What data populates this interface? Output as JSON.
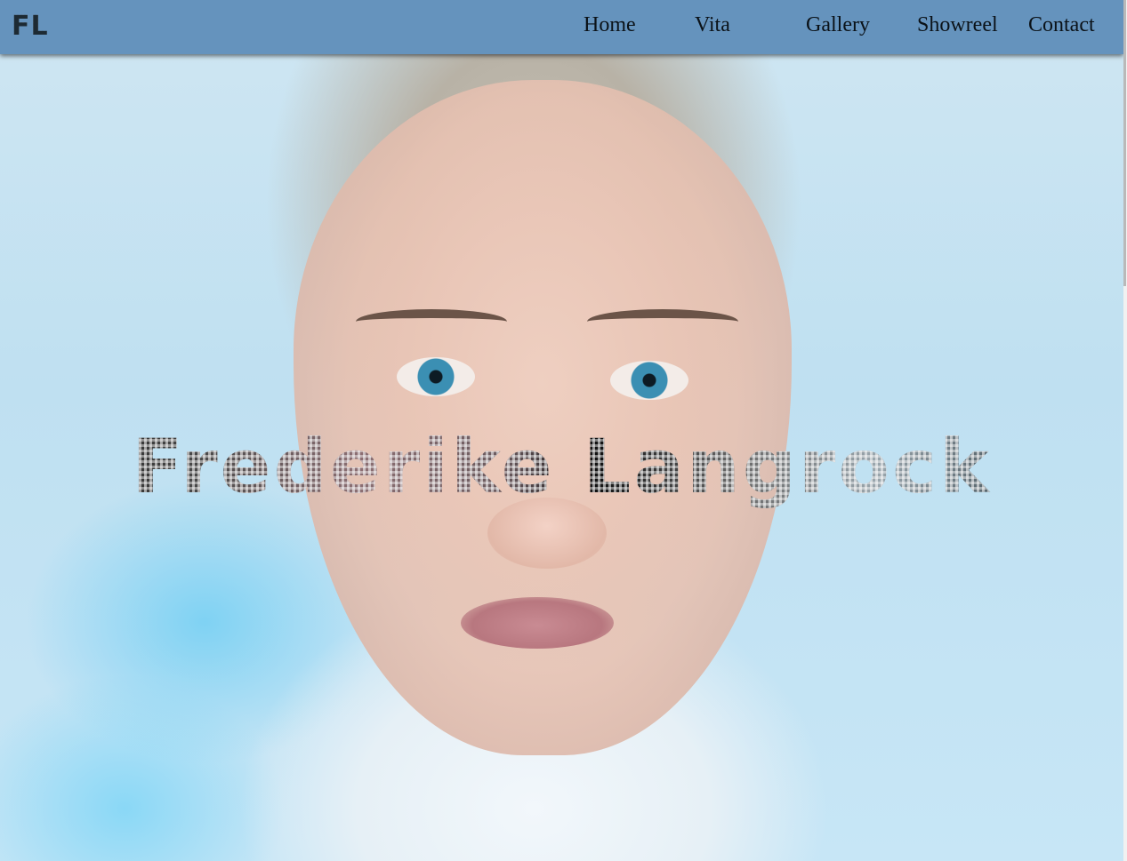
{
  "logo": {
    "text": "FL"
  },
  "nav": {
    "items": [
      {
        "label": "Home"
      },
      {
        "label": "Vita"
      },
      {
        "label": "Gallery"
      },
      {
        "label": "Showreel"
      },
      {
        "label": "Contact"
      }
    ]
  },
  "hero": {
    "title": "Frederike Langrock",
    "image_description_icon": "portrait-photo"
  },
  "colors": {
    "navbar": "#6593bd",
    "nav_text": "#0b1218",
    "hero_background": "#c7e6f6"
  }
}
